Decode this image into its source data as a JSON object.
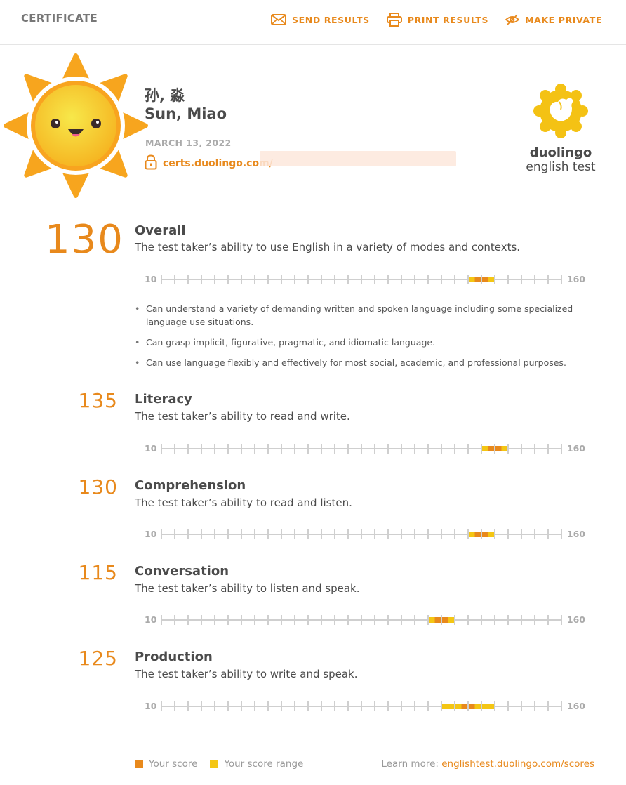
{
  "header": {
    "title": "CERTIFICATE",
    "actions": [
      {
        "label": "SEND RESULTS",
        "icon": "envelope-icon"
      },
      {
        "label": "PRINT RESULTS",
        "icon": "printer-icon"
      },
      {
        "label": "MAKE PRIVATE",
        "icon": "eye-slash-icon"
      }
    ]
  },
  "candidate": {
    "name_native": "孙, 淼",
    "name_latin": "Sun, Miao",
    "date": "MARCH 13, 2022",
    "cert_link": "certs.duolingo.com/"
  },
  "logo": {
    "word": "duolingo",
    "sub": "english test"
  },
  "scale": {
    "min": 10,
    "max": 160,
    "min_label": "10",
    "max_label": "160"
  },
  "sections": {
    "overall": {
      "score": "130",
      "title": "Overall",
      "desc": "The test taker’s ability to use English in a variety of modes and contexts.",
      "value": 130,
      "range": [
        125,
        135
      ],
      "bullets": [
        "Can understand a variety of demanding written and spoken language including some specialized language use situations.",
        "Can grasp implicit, figurative, pragmatic, and idiomatic language.",
        "Can use language flexibly and effectively for most social, academic, and professional purposes."
      ]
    },
    "literacy": {
      "score": "135",
      "title": "Literacy",
      "desc": "The test taker’s ability to read and write.",
      "value": 135,
      "range": [
        130,
        140
      ]
    },
    "comprehension": {
      "score": "130",
      "title": "Comprehension",
      "desc": "The test taker’s ability to read and listen.",
      "value": 130,
      "range": [
        125,
        135
      ]
    },
    "conversation": {
      "score": "115",
      "title": "Conversation",
      "desc": "The test taker’s ability to listen and speak.",
      "value": 115,
      "range": [
        110,
        120
      ]
    },
    "production": {
      "score": "125",
      "title": "Production",
      "desc": "The test taker’s ability to write and speak.",
      "value": 125,
      "range": [
        115,
        135
      ]
    }
  },
  "footer": {
    "your_score": "Your score",
    "your_range": "Your score range",
    "learn_more": "Learn more: ",
    "learn_link": "englishtest.duolingo.com/scores"
  },
  "colors": {
    "accent": "#e8891c",
    "score": "#e8891c",
    "range": "#f4c614",
    "track": "#cfcfcf"
  }
}
